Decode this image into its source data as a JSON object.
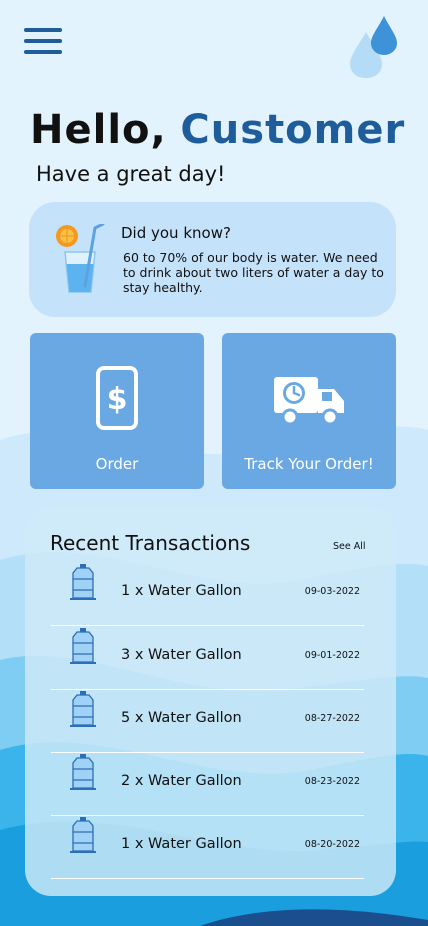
{
  "header": {
    "menu_icon": "hamburger-menu-icon",
    "logo_icon": "water-drops-logo-icon"
  },
  "greeting": {
    "hello": "Hello,",
    "name": "Customer",
    "subtitle": "Have a great day!"
  },
  "fact": {
    "icon": "water-glass-icon",
    "title": "Did you know?",
    "text": "60 to 70% of our body is water. We need to drink about two liters of water a day to stay healthy."
  },
  "actions": [
    {
      "label": "Order",
      "icon": "phone-dollar-icon"
    },
    {
      "label": "Track Your Order!",
      "icon": "delivery-truck-clock-icon"
    }
  ],
  "transactions": {
    "title": "Recent Transactions",
    "see_all": "See All",
    "items": [
      {
        "item": "1 x Water Gallon",
        "date": "09-03-2022",
        "icon": "water-gallon-icon"
      },
      {
        "item": "3 x Water Gallon",
        "date": "09-01-2022",
        "icon": "water-gallon-icon"
      },
      {
        "item": "5 x Water Gallon",
        "date": "08-27-2022",
        "icon": "water-gallon-icon"
      },
      {
        "item": "2 x Water Gallon",
        "date": "08-23-2022",
        "icon": "water-gallon-icon"
      },
      {
        "item": "1 x Water Gallon",
        "date": "08-20-2022",
        "icon": "water-gallon-icon"
      }
    ]
  },
  "colors": {
    "background": "#e3f3fd",
    "accent": "#1f5c9a",
    "card": "#6aa8e4",
    "fact_card": "#c5e2fb"
  }
}
